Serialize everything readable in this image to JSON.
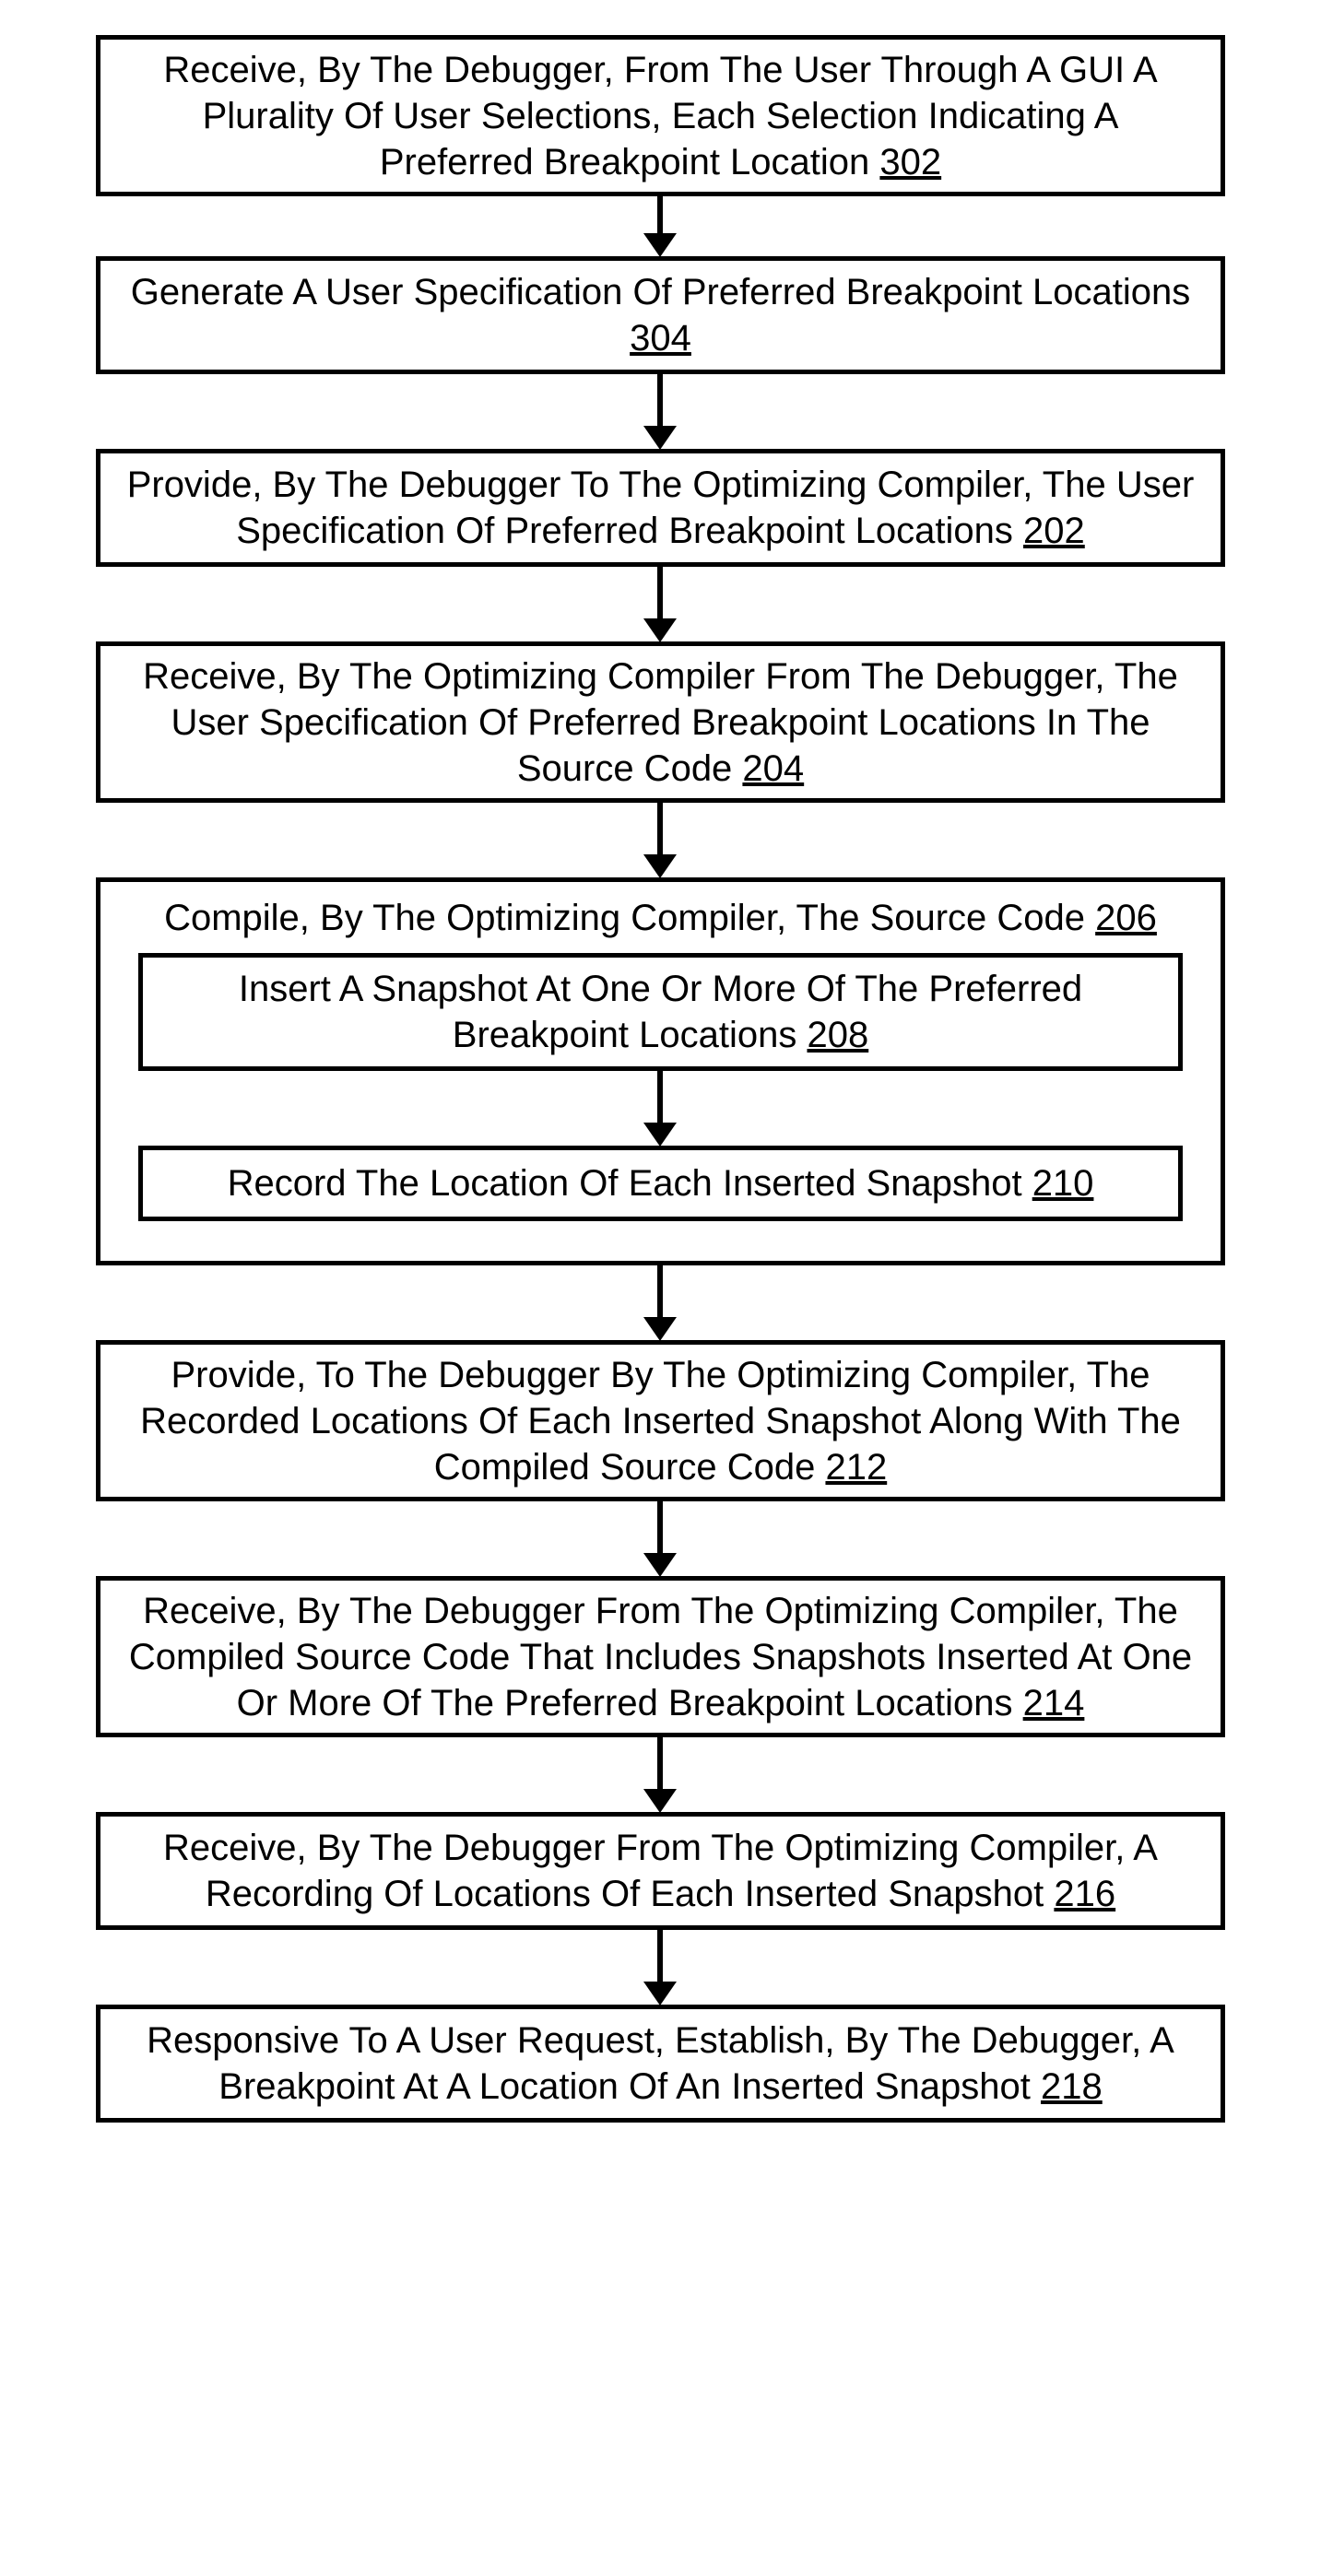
{
  "boxes": {
    "b302": {
      "text": "Receive, By The Debugger, From The User Through A GUI A Plurality Of User Selections, Each Selection Indicating A Preferred Breakpoint Location ",
      "ref": "302"
    },
    "b304": {
      "text": "Generate A User Specification Of Preferred Breakpoint Locations ",
      "ref": "304"
    },
    "b202": {
      "text": "Provide, By The Debugger To The Optimizing Compiler, The User Specification Of Preferred Breakpoint Locations ",
      "ref": "202"
    },
    "b204": {
      "text": "Receive, By The Optimizing Compiler From The Debugger, The User Specification Of Preferred Breakpoint Locations In The Source Code ",
      "ref": "204"
    },
    "b206": {
      "text": "Compile, By The Optimizing Compiler, The Source Code ",
      "ref": "206"
    },
    "b208": {
      "text": "Insert A Snapshot At One Or More Of The Preferred Breakpoint Locations ",
      "ref": "208"
    },
    "b210": {
      "text": "Record The Location Of Each Inserted Snapshot ",
      "ref": "210"
    },
    "b212": {
      "text": "Provide, To The Debugger By The Optimizing Compiler, The Recorded Locations Of Each Inserted Snapshot Along With The Compiled Source Code ",
      "ref": "212"
    },
    "b214": {
      "text": "Receive, By The Debugger From The Optimizing Compiler, The Compiled Source Code That Includes Snapshots Inserted At One Or More Of The Preferred Breakpoint Locations ",
      "ref": "214"
    },
    "b216": {
      "text": "Receive, By The Debugger From The Optimizing Compiler, A Recording Of Locations Of Each Inserted Snapshot ",
      "ref": "216"
    },
    "b218": {
      "text": "Responsive To A User Request, Establish, By The Debugger, A Breakpoint At A Location Of An Inserted Snapshot ",
      "ref": "218"
    }
  }
}
